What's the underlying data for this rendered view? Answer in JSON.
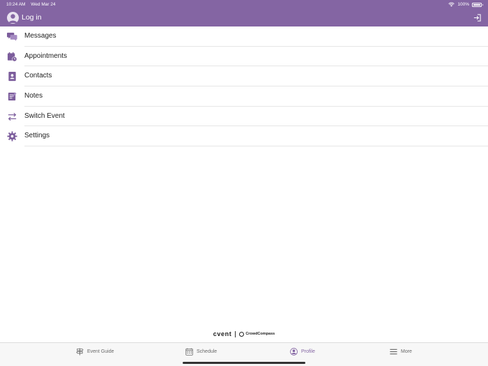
{
  "status_bar": {
    "time": "10:24 AM",
    "date": "Wed Mar 24",
    "battery": "100%"
  },
  "header": {
    "login_label": "Log in",
    "background_color": "#8465a3"
  },
  "menu": {
    "items": [
      {
        "label": "Messages",
        "icon": "messages-icon"
      },
      {
        "label": "Appointments",
        "icon": "appointments-icon"
      },
      {
        "label": "Contacts",
        "icon": "contacts-icon"
      },
      {
        "label": "Notes",
        "icon": "notes-icon"
      },
      {
        "label": "Switch Event",
        "icon": "switch-event-icon"
      },
      {
        "label": "Settings",
        "icon": "settings-icon"
      }
    ]
  },
  "branding": {
    "cvent": "cvent",
    "crowdcompass": "CrowdCompass"
  },
  "tabs": {
    "items": [
      {
        "label": "Event Guide",
        "icon": "signpost-icon",
        "active": false
      },
      {
        "label": "Schedule",
        "icon": "calendar-icon",
        "active": false
      },
      {
        "label": "Profile",
        "icon": "profile-icon",
        "active": true
      },
      {
        "label": "More",
        "icon": "hamburger-menu-icon",
        "active": false
      }
    ]
  }
}
